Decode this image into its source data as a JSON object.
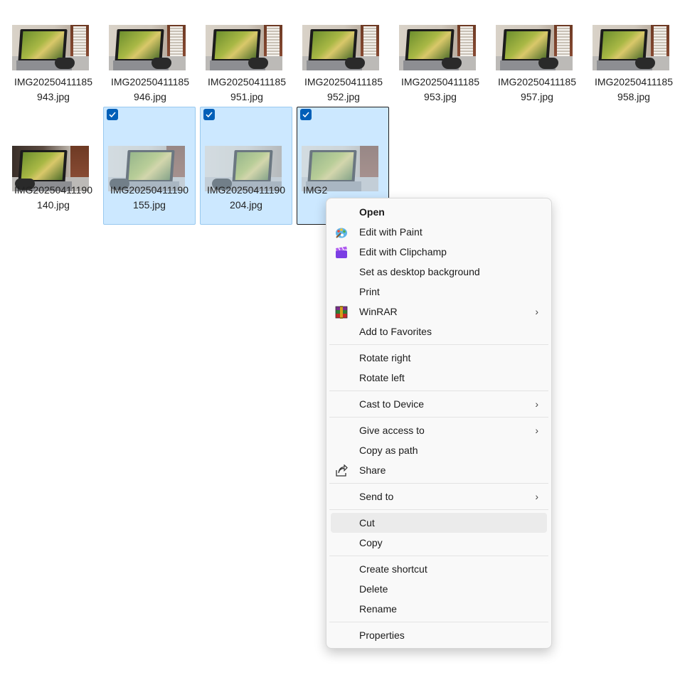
{
  "files": [
    {
      "line1": "IMG20250411185",
      "line2": "943.jpg",
      "selected": false
    },
    {
      "line1": "IMG20250411185",
      "line2": "946.jpg",
      "selected": false
    },
    {
      "line1": "IMG20250411185",
      "line2": "951.jpg",
      "selected": false
    },
    {
      "line1": "IMG20250411185",
      "line2": "952.jpg",
      "selected": false
    },
    {
      "line1": "IMG20250411185",
      "line2": "953.jpg",
      "selected": false
    },
    {
      "line1": "IMG20250411185",
      "line2": "957.jpg",
      "selected": false
    },
    {
      "line1": "IMG20250411185",
      "line2": "958.jpg",
      "selected": false
    },
    {
      "line1": "IMG20250411190",
      "line2": "140.jpg",
      "selected": false
    },
    {
      "line1": "IMG20250411190",
      "line2": "155.jpg",
      "selected": true
    },
    {
      "line1": "IMG20250411190",
      "line2": "204.jpg",
      "selected": true
    },
    {
      "line1": "IMG2",
      "line2": "",
      "selected": true
    }
  ],
  "context_menu": {
    "open": "Open",
    "edit_paint": "Edit with Paint",
    "edit_clipchamp": "Edit with Clipchamp",
    "set_background": "Set as desktop background",
    "print": "Print",
    "winrar": "WinRAR",
    "add_favorites": "Add to Favorites",
    "rotate_right": "Rotate right",
    "rotate_left": "Rotate left",
    "cast": "Cast to Device",
    "give_access": "Give access to",
    "copy_path": "Copy as path",
    "share": "Share",
    "send_to": "Send to",
    "cut": "Cut",
    "copy": "Copy",
    "create_shortcut": "Create shortcut",
    "delete": "Delete",
    "rename": "Rename",
    "properties": "Properties",
    "submenu_chevron": "›"
  },
  "colors": {
    "selection_bg": "#cce8ff",
    "selection_border": "#99c9ef",
    "checkbox": "#005fb8",
    "menu_hover": "#ebebeb"
  }
}
